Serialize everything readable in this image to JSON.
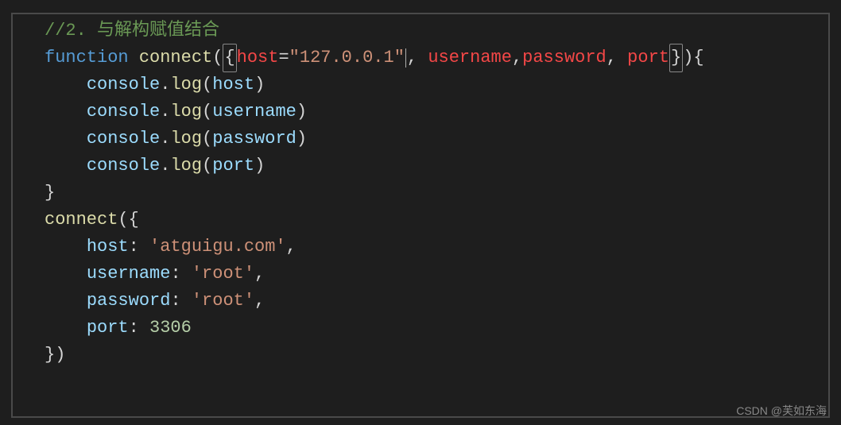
{
  "code": {
    "l1_comment": "//2. 与解构赋值结合",
    "l2": {
      "kw_function": "function",
      "funcname": "connect",
      "lparen": "(",
      "lbrace": "{",
      "p_host": "host",
      "eq": "=",
      "host_default": "\"127.0.0.1\"",
      "c1": ",",
      "p_username": "username",
      "c2": ",",
      "p_password": "password",
      "c3": ",",
      "p_port": "port",
      "rbrace": "}",
      "rparen": ")",
      "lcurly": "{"
    },
    "l3": {
      "obj": "console",
      "dot": ".",
      "method": "log",
      "lp": "(",
      "arg": "host",
      "rp": ")"
    },
    "l4": {
      "obj": "console",
      "dot": ".",
      "method": "log",
      "lp": "(",
      "arg": "username",
      "rp": ")"
    },
    "l5": {
      "obj": "console",
      "dot": ".",
      "method": "log",
      "lp": "(",
      "arg": "password",
      "rp": ")"
    },
    "l6": {
      "obj": "console",
      "dot": ".",
      "method": "log",
      "lp": "(",
      "arg": "port",
      "rp": ")"
    },
    "l7_rbrace": "}",
    "l8": {
      "funcname": "connect",
      "lparen": "(",
      "lbrace": "{"
    },
    "l9": {
      "key": "host",
      "colon": ":",
      "val": "'atguigu.com'",
      "comma": ","
    },
    "l10": {
      "key": "username",
      "colon": ":",
      "val": "'root'",
      "comma": ","
    },
    "l11": {
      "key": "password",
      "colon": ":",
      "val": "'root'",
      "comma": ","
    },
    "l12": {
      "key": "port",
      "colon": ":",
      "val": "3306"
    },
    "l13": {
      "rbrace": "}",
      "rparen": ")"
    }
  },
  "watermark": "CSDN @芙如东海"
}
